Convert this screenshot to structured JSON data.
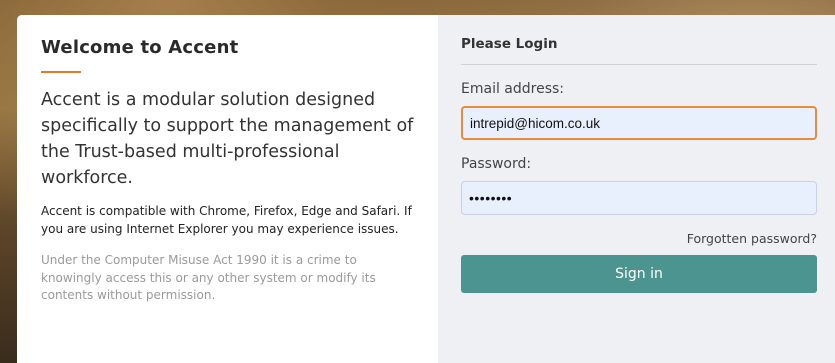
{
  "welcome": {
    "title": "Welcome to Accent",
    "lead": "Accent is a modular solution designed specifically to support the management of the Trust-based multi-professional workforce.",
    "compatibility": "Accent is compatible with Chrome, Firefox, Edge and Safari. If you are using Internet Explorer you may experience issues.",
    "misuse_notice": "Under the Computer Misuse Act 1990 it is a crime to knowingly access this or any other system or modify its contents without permission."
  },
  "login": {
    "title": "Please Login",
    "email_label": "Email address:",
    "email_value": "intrepid@hicom.co.uk",
    "password_label": "Password:",
    "password_value": "password",
    "forgot_label": "Forgotten password?",
    "signin_label": "Sign in"
  },
  "colors": {
    "accent_orange": "#e07b2a",
    "button_teal": "#4b9490",
    "panel_gray": "#eef0f3",
    "input_fill": "#e8f0fe"
  }
}
